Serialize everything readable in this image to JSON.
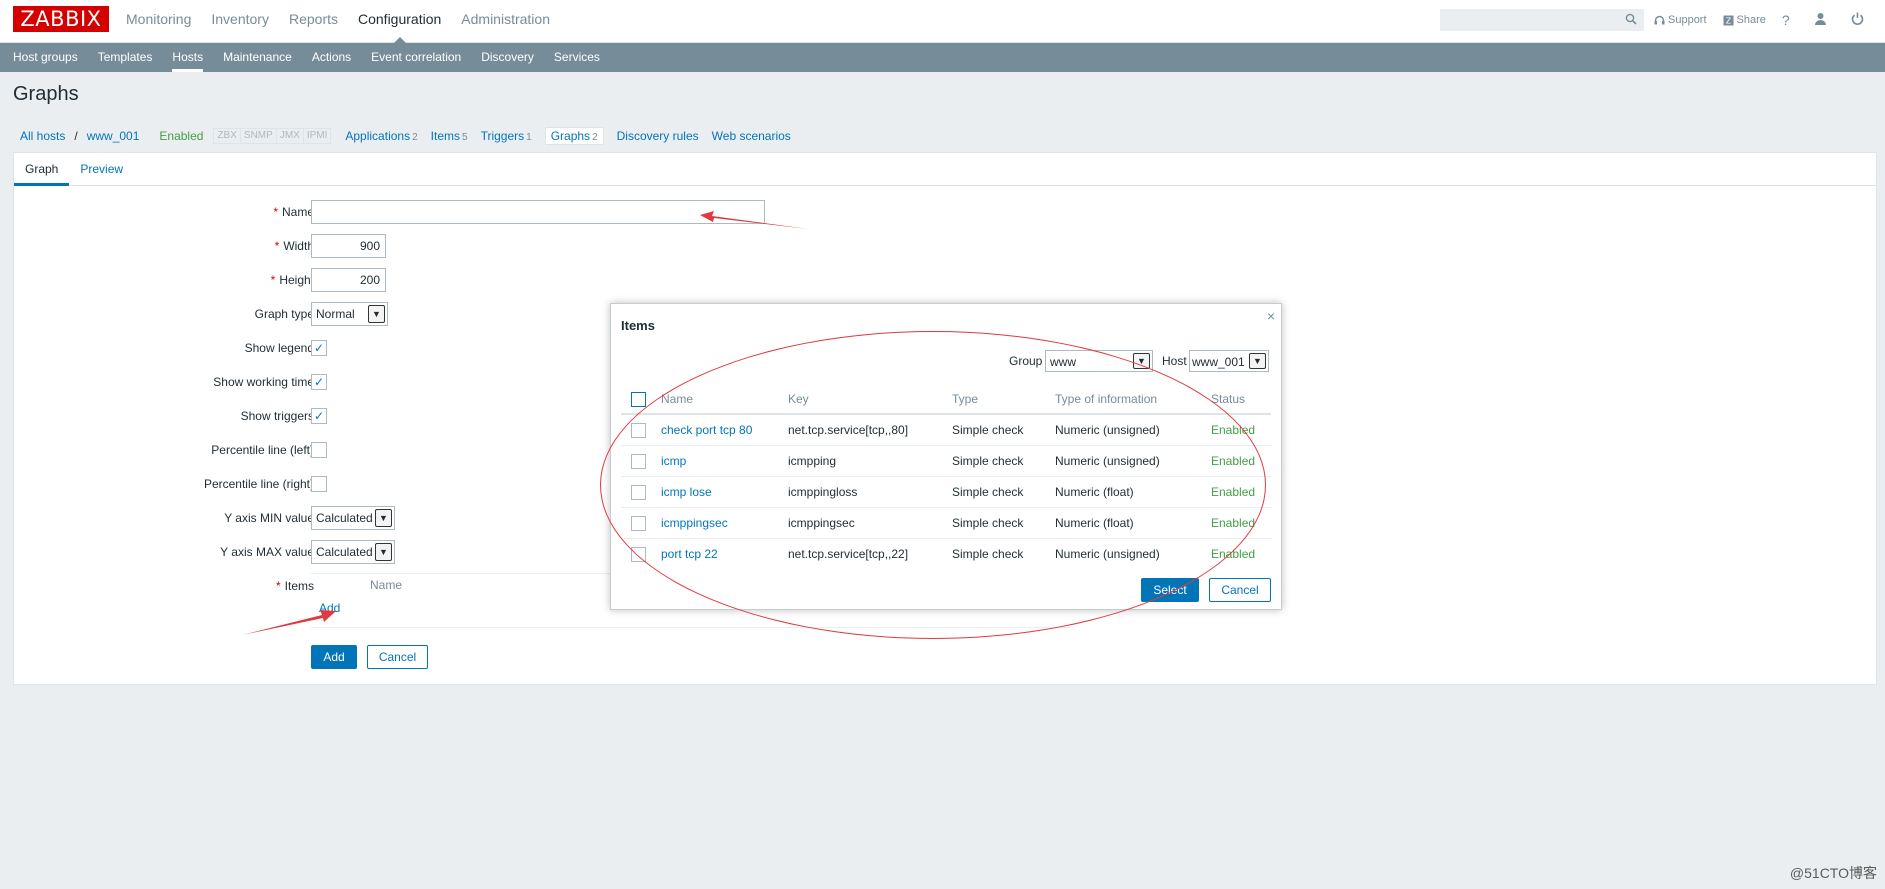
{
  "header": {
    "logo": "ZABBIX",
    "main_nav": [
      "Monitoring",
      "Inventory",
      "Reports",
      "Configuration",
      "Administration"
    ],
    "active_main": "Configuration",
    "support_label": "Support",
    "share_label": "Share",
    "help_label": "?"
  },
  "sub_nav": [
    "Host groups",
    "Templates",
    "Hosts",
    "Maintenance",
    "Actions",
    "Event correlation",
    "Discovery",
    "Services"
  ],
  "page_title": "Graphs",
  "breadcrumb": {
    "all_hosts": "All hosts",
    "separator": "/",
    "host": "www_001",
    "status": "Enabled",
    "badges": [
      "ZBX",
      "SNMP",
      "JMX",
      "IPMI"
    ],
    "tabs": [
      {
        "label": "Applications",
        "count": "2"
      },
      {
        "label": "Items",
        "count": "5"
      },
      {
        "label": "Triggers",
        "count": "1"
      },
      {
        "label": "Graphs",
        "count": "2"
      },
      {
        "label": "Discovery rules",
        "count": ""
      },
      {
        "label": "Web scenarios",
        "count": ""
      }
    ]
  },
  "form_tabs": [
    "Graph",
    "Preview"
  ],
  "form": {
    "name_label": "Name",
    "name_value": "",
    "width_label": "Width",
    "width_value": "900",
    "height_label": "Height",
    "height_value": "200",
    "graph_type_label": "Graph type",
    "graph_type_value": "Normal",
    "show_legend_label": "Show legend",
    "show_working_time_label": "Show working time",
    "show_triggers_label": "Show triggers",
    "percentile_left_label": "Percentile line (left)",
    "percentile_right_label": "Percentile line (right)",
    "ymin_label": "Y axis MIN value",
    "ymin_value": "Calculated",
    "ymax_label": "Y axis MAX value",
    "ymax_value": "Calculated",
    "items_label": "Items",
    "items_col_name": "Name",
    "items_add_link": "Add",
    "add_button": "Add",
    "cancel_button": "Cancel",
    "required_mark": "*"
  },
  "modal": {
    "title": "Items",
    "close": "×",
    "group_label": "Group",
    "group_value": "www",
    "host_label": "Host",
    "host_value": "www_001",
    "columns": [
      "Name",
      "Key",
      "Type",
      "Type of information",
      "Status"
    ],
    "rows": [
      {
        "name": "check port tcp 80",
        "key": "net.tcp.service[tcp,,80]",
        "type": "Simple check",
        "info": "Numeric (unsigned)",
        "status": "Enabled"
      },
      {
        "name": "icmp",
        "key": "icmpping",
        "type": "Simple check",
        "info": "Numeric (unsigned)",
        "status": "Enabled"
      },
      {
        "name": "icmp lose",
        "key": "icmppingloss",
        "type": "Simple check",
        "info": "Numeric (float)",
        "status": "Enabled"
      },
      {
        "name": "icmppingsec",
        "key": "icmppingsec",
        "type": "Simple check",
        "info": "Numeric (float)",
        "status": "Enabled"
      },
      {
        "name": "port tcp 22",
        "key": "net.tcp.service[tcp,,22]",
        "type": "Simple check",
        "info": "Numeric (unsigned)",
        "status": "Enabled"
      }
    ],
    "select_button": "Select",
    "cancel_button": "Cancel"
  },
  "watermark": "@51CTO博客",
  "colors": {
    "brand": "#d40000",
    "link": "#0275b8",
    "subnav": "#768d99",
    "enabled": "#429e47",
    "annotation": "#e0393e"
  }
}
